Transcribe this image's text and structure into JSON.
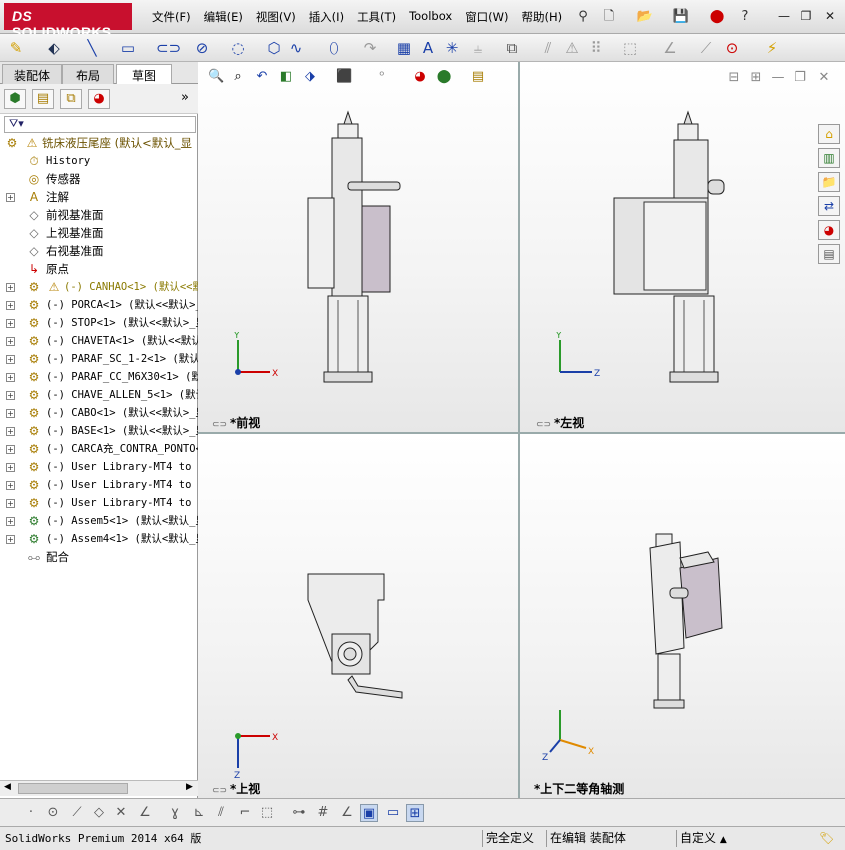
{
  "app": {
    "logo_text": "SOLIDWORKS",
    "logo_ds": "DS",
    "brand_color": "#c8102e"
  },
  "menus": [
    "文件(F)",
    "编辑(E)",
    "视图(V)",
    "插入(I)",
    "工具(T)",
    "Toolbox",
    "窗口(W)",
    "帮助(H)"
  ],
  "panel": {
    "tabs": [
      "装配体",
      "布局",
      "草图"
    ],
    "active_tab": "草图",
    "tree": [
      {
        "text": "铣床液压尾座  (默认<默认_显",
        "expander": false,
        "icon": "assembly-icon",
        "warn": true,
        "cn": true,
        "level": 0
      },
      {
        "text": "History",
        "expander": false,
        "icon": "history-icon",
        "cn": false,
        "level": 1
      },
      {
        "text": "传感器",
        "expander": false,
        "icon": "sensor-icon",
        "cn": true,
        "level": 1
      },
      {
        "text": "注解",
        "expander": true,
        "icon": "annotation-icon",
        "cn": true,
        "level": 1
      },
      {
        "text": "前视基准面",
        "expander": false,
        "icon": "plane-icon",
        "cn": true,
        "level": 1
      },
      {
        "text": "上视基准面",
        "expander": false,
        "icon": "plane-icon",
        "cn": true,
        "level": 1
      },
      {
        "text": "右视基准面",
        "expander": false,
        "icon": "plane-icon",
        "cn": true,
        "level": 1
      },
      {
        "text": "原点",
        "expander": false,
        "icon": "origin-icon",
        "cn": true,
        "level": 1
      },
      {
        "text": "(-) CANHAO<1> (默认<<默",
        "expander": true,
        "icon": "part-icon",
        "warn": true,
        "cn": false,
        "level": 1
      },
      {
        "text": "(-) PORCA<1> (默认<<默认>_",
        "expander": true,
        "icon": "part-icon",
        "cn": false,
        "level": 1
      },
      {
        "text": "(-) STOP<1> (默认<<默认>_显",
        "expander": true,
        "icon": "part-icon",
        "cn": false,
        "level": 1
      },
      {
        "text": "(-) CHAVETA<1> (默认<<默认",
        "expander": true,
        "icon": "part-icon",
        "cn": false,
        "level": 1
      },
      {
        "text": "(-) PARAF_SC_1-2<1> (默认",
        "expander": true,
        "icon": "part-icon",
        "cn": false,
        "level": 1
      },
      {
        "text": "(-) PARAF_CC_M6X30<1> (默认",
        "expander": true,
        "icon": "part-icon",
        "cn": false,
        "level": 1
      },
      {
        "text": "(-) CHAVE_ALLEN_5<1> (默认",
        "expander": true,
        "icon": "part-icon",
        "cn": false,
        "level": 1
      },
      {
        "text": "(-) CABO<1> (默认<<默认>_显",
        "expander": true,
        "icon": "part-icon",
        "cn": false,
        "level": 1
      },
      {
        "text": "(-) BASE<1> (默认<<默认>_显",
        "expander": true,
        "icon": "part-icon",
        "cn": false,
        "level": 1
      },
      {
        "text": "(-) CARCA充_CONTRA_PONTO<",
        "expander": true,
        "icon": "part-icon",
        "cn": false,
        "level": 1
      },
      {
        "text": "(-) User Library-MT4 to M7",
        "expander": true,
        "icon": "part-icon",
        "cn": false,
        "level": 1
      },
      {
        "text": "(-) User Library-MT4 to M7",
        "expander": true,
        "icon": "part-icon",
        "cn": false,
        "level": 1
      },
      {
        "text": "(-) User Library-MT4 to M7",
        "expander": true,
        "icon": "part-icon",
        "cn": false,
        "level": 1
      },
      {
        "text": "(-) Assem5<1> (默认<默认_显",
        "expander": true,
        "icon": "subassembly-icon",
        "cn": false,
        "level": 1
      },
      {
        "text": "(-) Assem4<1> (默认<默认_显",
        "expander": true,
        "icon": "subassembly-icon",
        "cn": false,
        "level": 1
      },
      {
        "text": "配合",
        "expander": false,
        "icon": "mates-icon",
        "cn": true,
        "level": 1
      }
    ]
  },
  "views": {
    "front": "*前视",
    "left": "*左视",
    "top": "*上视",
    "iso": "*上下二等角轴测"
  },
  "axes": {
    "x": "X",
    "y": "Y",
    "z": "Z"
  },
  "status": {
    "version": "SolidWorks Premium 2014 x64 版",
    "defined": "完全定义",
    "editing": "在编辑 装配体",
    "units": "自定义"
  }
}
